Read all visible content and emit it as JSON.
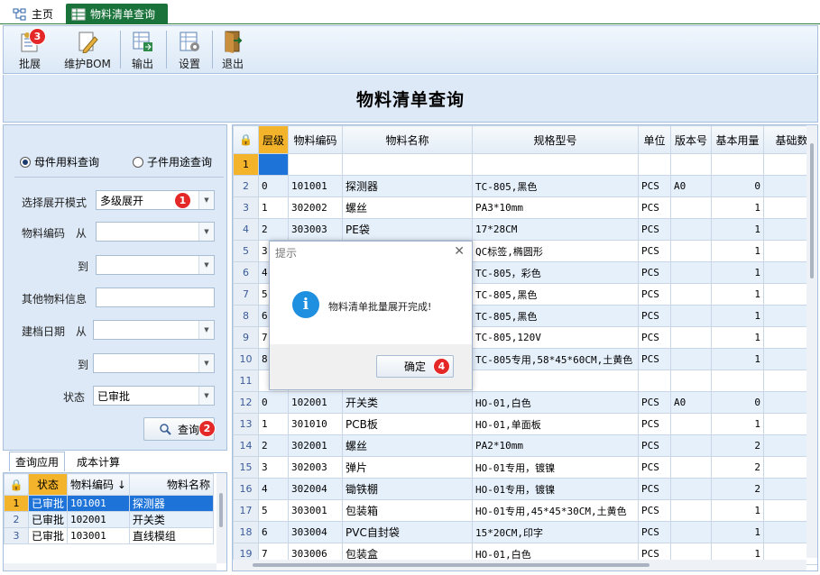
{
  "tabs": {
    "home": "主页",
    "active": "物料清单查询"
  },
  "toolbar": {
    "batch": "批展",
    "batch_badge": "3",
    "maintain": "维护BOM",
    "export": "输出",
    "settings": "设置",
    "exit": "退出"
  },
  "page_title": "物料清单查询",
  "query": {
    "radio_parent": "母件用料查询",
    "radio_child": "子件用途查询",
    "mode_label": "选择展开模式",
    "mode_value": "多级展开",
    "mode_badge": "1",
    "code_label": "物料编码",
    "from": "从",
    "to": "到",
    "other_label": "其他物料信息",
    "date_label": "建档日期",
    "status_label": "状态",
    "status_value": "已审批",
    "search_button": "查询",
    "search_badge": "2"
  },
  "bottom_tabs": [
    "查询应用",
    "成本计算"
  ],
  "left_grid": {
    "headers": [
      "状态",
      "物料编码",
      "物料名称"
    ],
    "sort_indicator": "↓",
    "rows": [
      {
        "n": "1",
        "status": "已审批",
        "code": "101001",
        "name": "探测器"
      },
      {
        "n": "2",
        "status": "已审批",
        "code": "102001",
        "name": "开关类"
      },
      {
        "n": "3",
        "status": "已审批",
        "code": "103001",
        "name": "直线模组"
      }
    ]
  },
  "right_grid": {
    "headers": [
      "层级",
      "物料编码",
      "物料名称",
      "规格型号",
      "单位",
      "版本号",
      "基本用量",
      "基础数"
    ],
    "rows": [
      {
        "n": "1",
        "lv": "",
        "code": "",
        "name": "",
        "spec": "",
        "unit": "",
        "ver": "",
        "qty": ""
      },
      {
        "n": "2",
        "lv": "0",
        "code": "101001",
        "name": "探测器",
        "spec": "TC-805,黑色",
        "unit": "PCS",
        "ver": "A0",
        "qty": "0"
      },
      {
        "n": "3",
        "lv": "1",
        "code": "302002",
        "name": "螺丝",
        "spec": "PA3*10mm",
        "unit": "PCS",
        "ver": "",
        "qty": "1"
      },
      {
        "n": "4",
        "lv": "2",
        "code": "303003",
        "name": "PE袋",
        "spec": "17*28CM",
        "unit": "PCS",
        "ver": "",
        "qty": "1"
      },
      {
        "n": "5",
        "lv": "3",
        "code": "",
        "name": "",
        "spec": "QC标签,椭圆形",
        "unit": "PCS",
        "ver": "",
        "qty": "1"
      },
      {
        "n": "6",
        "lv": "4",
        "code": "",
        "name": "",
        "spec": "TC-805，彩色",
        "unit": "PCS",
        "ver": "",
        "qty": "1"
      },
      {
        "n": "7",
        "lv": "5",
        "code": "",
        "name": "",
        "spec": "TC-805,黑色",
        "unit": "PCS",
        "ver": "",
        "qty": "1"
      },
      {
        "n": "8",
        "lv": "6",
        "code": "",
        "name": "",
        "spec": "TC-805,黑色",
        "unit": "PCS",
        "ver": "",
        "qty": "1"
      },
      {
        "n": "9",
        "lv": "7",
        "code": "",
        "name": "",
        "spec": "TC-805,120V",
        "unit": "PCS",
        "ver": "",
        "qty": "1"
      },
      {
        "n": "10",
        "lv": "8",
        "code": "",
        "name": "",
        "spec": "TC-805专用,58*45*60CM,土黄色",
        "unit": "PCS",
        "ver": "",
        "qty": "1"
      },
      {
        "n": "11",
        "lv": "",
        "code": "",
        "name": "",
        "spec": "",
        "unit": "",
        "ver": "",
        "qty": ""
      },
      {
        "n": "12",
        "lv": "0",
        "code": "102001",
        "name": "开关类",
        "spec": "HO-01,白色",
        "unit": "PCS",
        "ver": "A0",
        "qty": "0"
      },
      {
        "n": "13",
        "lv": "1",
        "code": "301010",
        "name": "PCB板",
        "spec": "HO-01,单面板",
        "unit": "PCS",
        "ver": "",
        "qty": "1"
      },
      {
        "n": "14",
        "lv": "2",
        "code": "302001",
        "name": "螺丝",
        "spec": "PA2*10mm",
        "unit": "PCS",
        "ver": "",
        "qty": "2"
      },
      {
        "n": "15",
        "lv": "3",
        "code": "302003",
        "name": "弹片",
        "spec": "HO-01专用，镀镍",
        "unit": "PCS",
        "ver": "",
        "qty": "2"
      },
      {
        "n": "16",
        "lv": "4",
        "code": "302004",
        "name": "锄铁棚",
        "spec": "HO-01专用，镀镍",
        "unit": "PCS",
        "ver": "",
        "qty": "2"
      },
      {
        "n": "17",
        "lv": "5",
        "code": "303001",
        "name": "包装箱",
        "spec": "HO-01专用,45*45*30CM,土黄色",
        "unit": "PCS",
        "ver": "",
        "qty": "1"
      },
      {
        "n": "18",
        "lv": "6",
        "code": "303004",
        "name": "PVC自封袋",
        "spec": "15*20CM,印字",
        "unit": "PCS",
        "ver": "",
        "qty": "1"
      },
      {
        "n": "19",
        "lv": "7",
        "code": "303006",
        "name": "包装盒",
        "spec": "HO-01,白色",
        "unit": "PCS",
        "ver": "",
        "qty": "1"
      }
    ]
  },
  "dialog": {
    "title": "提示",
    "message": "物料清单批量展开完成!",
    "ok": "确定",
    "ok_badge": "4"
  }
}
